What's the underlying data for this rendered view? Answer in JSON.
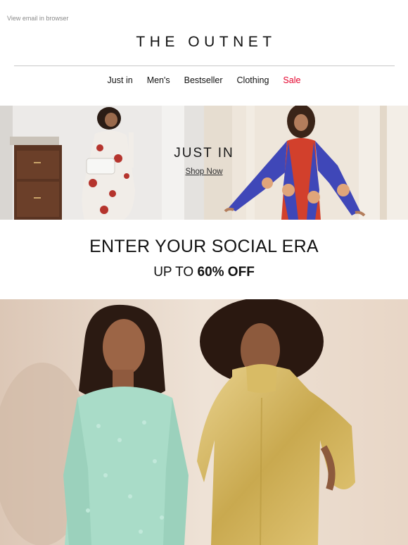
{
  "preheader": {
    "view_in_browser": "View email in browser"
  },
  "brand": {
    "logo_text": "THE OUTNET"
  },
  "nav": {
    "items": [
      {
        "label": "Just in"
      },
      {
        "label": "Men's"
      },
      {
        "label": "Bestseller"
      },
      {
        "label": "Clothing"
      },
      {
        "label": "Sale"
      }
    ]
  },
  "hero": {
    "title": "JUST IN",
    "cta": "Shop Now"
  },
  "promo": {
    "headline": "ENTER YOUR SOCIAL ERA",
    "sub_prefix": "UP TO ",
    "sub_bold": "60% OFF"
  },
  "colors": {
    "sale": "#e4002b",
    "text": "#111111",
    "divider": "#c8c8c8"
  }
}
